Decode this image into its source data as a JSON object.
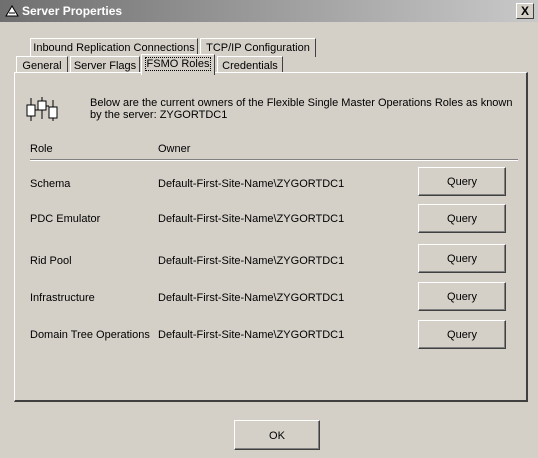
{
  "window": {
    "title": "Server Properties",
    "close_label": "X"
  },
  "tabs_row1": [
    {
      "label": "Inbound Replication Connections"
    },
    {
      "label": "TCP/IP Configuration"
    }
  ],
  "tabs_row2": [
    {
      "label": "General"
    },
    {
      "label": "Server Flags"
    },
    {
      "label": "FSMO Roles",
      "active": true
    },
    {
      "label": "Credentials"
    }
  ],
  "panel": {
    "description": "Below are the current owners of the Flexible Single Master Operations Roles as known by the server: ZYGORTDC1",
    "headers": {
      "role": "Role",
      "owner": "Owner"
    },
    "rows": [
      {
        "role": "Schema",
        "owner": "Default-First-Site-Name\\ZYGORTDC1",
        "button": "Query"
      },
      {
        "role": "PDC Emulator",
        "owner": "Default-First-Site-Name\\ZYGORTDC1",
        "button": "Query"
      },
      {
        "role": "Rid Pool",
        "owner": "Default-First-Site-Name\\ZYGORTDC1",
        "button": "Query"
      },
      {
        "role": "Infrastructure",
        "owner": "Default-First-Site-Name\\ZYGORTDC1",
        "button": "Query"
      },
      {
        "role": "Domain Tree Operations",
        "owner": "Default-First-Site-Name\\ZYGORTDC1",
        "button": "Query"
      }
    ]
  },
  "footer": {
    "ok_label": "OK"
  }
}
